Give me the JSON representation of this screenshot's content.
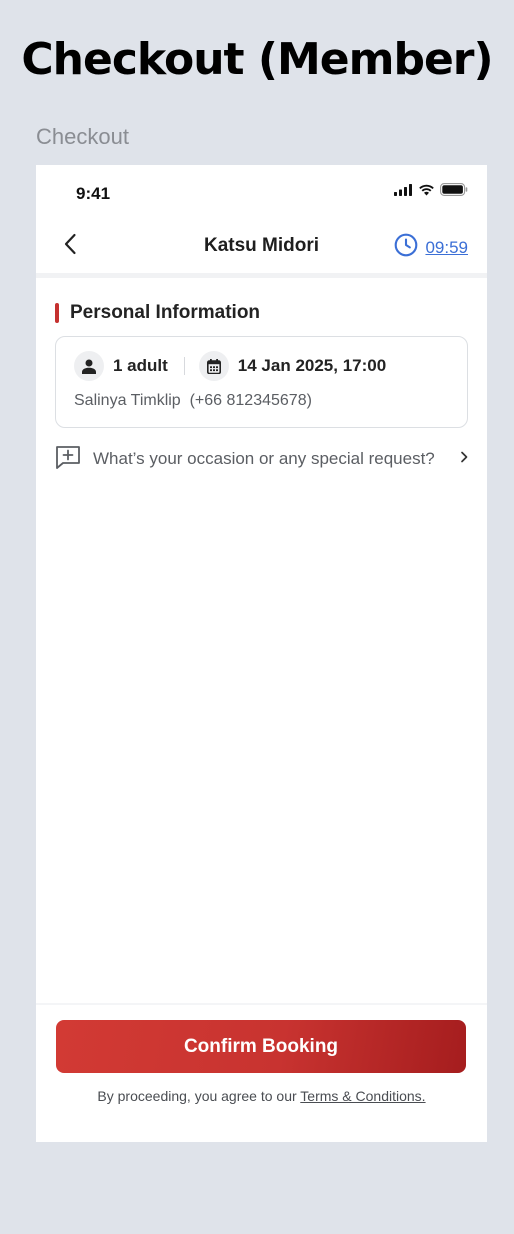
{
  "page": {
    "title": "Checkout (Member)",
    "section_label": "Checkout"
  },
  "status_bar": {
    "time": "9:41",
    "icons": [
      "cellular-signal-icon",
      "wifi-icon",
      "battery-icon"
    ]
  },
  "nav": {
    "title": "Katsu Midori",
    "back_icon": "chevron-left-icon",
    "timer_icon": "clock-icon",
    "timer": "09:59"
  },
  "personal_info": {
    "heading": "Personal Information",
    "guests_icon": "person-icon",
    "guests": "1 adult",
    "date_icon": "calendar-icon",
    "datetime": "14 Jan 2025, 17:00",
    "contact": "Salinya Timklip  (+66 812345678)"
  },
  "special_request": {
    "icon": "add-comment-icon",
    "placeholder": "What’s your occasion or any special request?",
    "chevron_icon": "chevron-right-icon"
  },
  "footer": {
    "confirm_label": "Confirm Booking",
    "terms_prefix": "By proceeding, you agree to our ",
    "terms_link": "Terms & Conditions."
  },
  "colors": {
    "accent_red": "#c5312f",
    "timer_blue": "#3b6fd6",
    "page_background": "#dfe3ea"
  }
}
